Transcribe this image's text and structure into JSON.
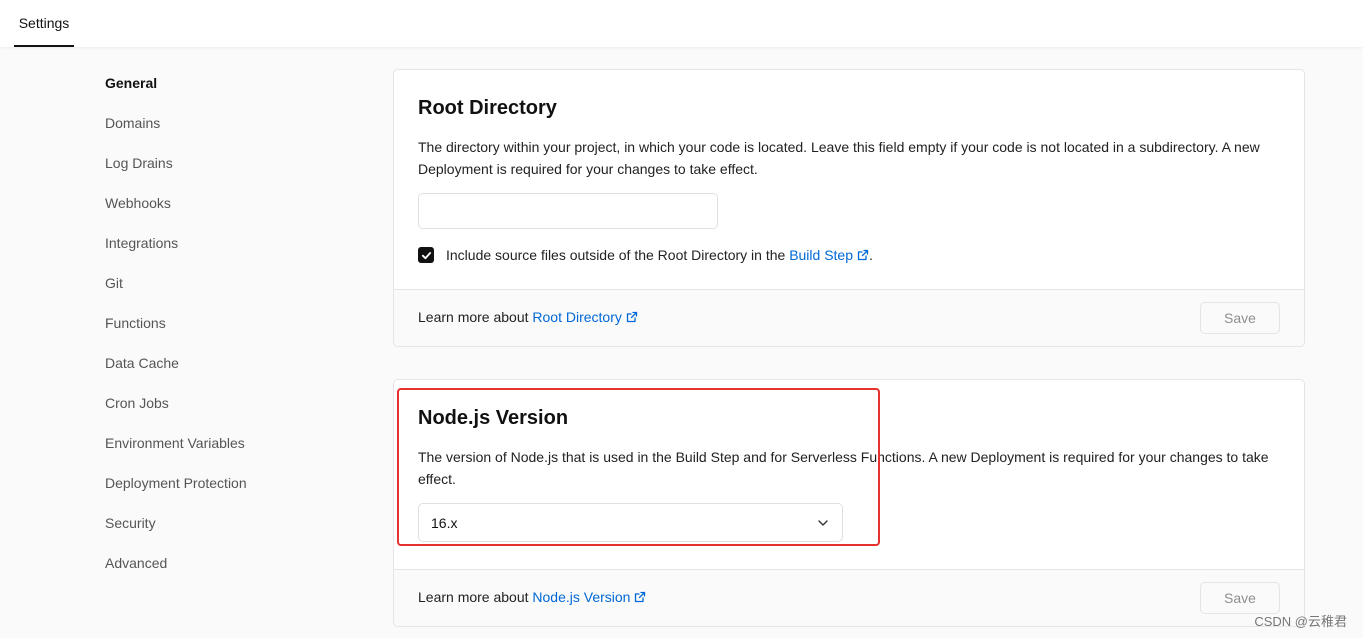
{
  "header": {
    "tab_label": "Settings"
  },
  "sidebar": {
    "items": [
      {
        "label": "General",
        "active": true
      },
      {
        "label": "Domains"
      },
      {
        "label": "Log Drains"
      },
      {
        "label": "Webhooks"
      },
      {
        "label": "Integrations"
      },
      {
        "label": "Git"
      },
      {
        "label": "Functions"
      },
      {
        "label": "Data Cache"
      },
      {
        "label": "Cron Jobs"
      },
      {
        "label": "Environment Variables"
      },
      {
        "label": "Deployment Protection"
      },
      {
        "label": "Security"
      },
      {
        "label": "Advanced"
      }
    ]
  },
  "root_directory": {
    "title": "Root Directory",
    "description": "The directory within your project, in which your code is located. Leave this field empty if your code is not located in a subdirectory. A new Deployment is required for your changes to take effect.",
    "input_value": "",
    "checkbox_checked": true,
    "checkbox_label_prefix": "Include source files outside of the Root Directory in the ",
    "checkbox_link": "Build Step",
    "checkbox_label_suffix": ".",
    "footer_prefix": "Learn more about ",
    "footer_link": "Root Directory",
    "save_label": "Save"
  },
  "node_version": {
    "title": "Node.js Version",
    "description": "The version of Node.js that is used in the Build Step and for Serverless Functions. A new Deployment is required for your changes to take effect.",
    "selected_value": "16.x",
    "footer_prefix": "Learn more about ",
    "footer_link": "Node.js Version",
    "save_label": "Save"
  },
  "watermark": "CSDN @云稚君",
  "colors": {
    "link": "#0068d6",
    "highlight": "#e5322d",
    "checkbox": "#111111"
  },
  "icons": {
    "external_link": "external-link-icon",
    "chevron": "chevron-down-icon",
    "check": "check-icon"
  }
}
